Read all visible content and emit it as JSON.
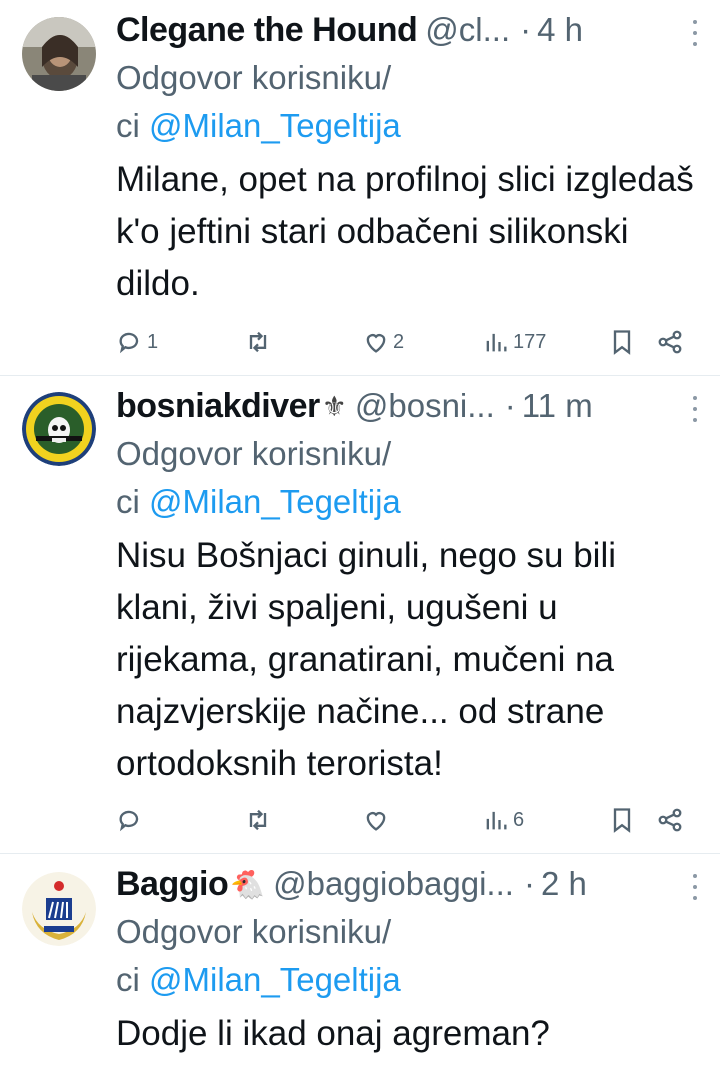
{
  "tweets": [
    {
      "name": "Clegane the Hound",
      "name_suffix": "",
      "handle": "@cl...",
      "time": "4 h",
      "reply_prefix": "Odgovor korisniku/",
      "reply_prefix2": "ci ",
      "reply_to": "@Milan_Tegeltija",
      "body": "Milane, opet na profilnoj slici izgledaš k'o jeftini stari odbačeni silikonski dildo.",
      "stats": {
        "replies": "1",
        "retweets": "",
        "likes": "2",
        "views": "177"
      }
    },
    {
      "name": "bosniakdiver",
      "name_suffix": "⚜",
      "handle": "@bosni...",
      "time": "11 m",
      "reply_prefix": "Odgovor korisniku/",
      "reply_prefix2": "ci ",
      "reply_to": "@Milan_Tegeltija",
      "body": "Nisu Bošnjaci ginuli, nego su bili klani, živi spaljeni, ugušeni u rijekama, granatirani, mučeni na najzvjerskije načine... od strane ortodoksnih terorista!",
      "stats": {
        "replies": "",
        "retweets": "",
        "likes": "",
        "views": "6"
      }
    },
    {
      "name": "Baggio",
      "name_suffix": "🐔",
      "handle": "@baggiobaggi...",
      "time": "2 h",
      "reply_prefix": "Odgovor korisniku/",
      "reply_prefix2": "ci ",
      "reply_to": "@Milan_Tegeltija",
      "body": "Dodje li ikad onaj agreman?"
    }
  ],
  "colors": {
    "link": "#1d9bf0",
    "secondary": "#536471",
    "text": "#0f1419"
  },
  "icons": [
    "reply-icon",
    "retweet-icon",
    "like-icon",
    "views-icon",
    "bookmark-icon",
    "share-icon",
    "more-icon"
  ]
}
